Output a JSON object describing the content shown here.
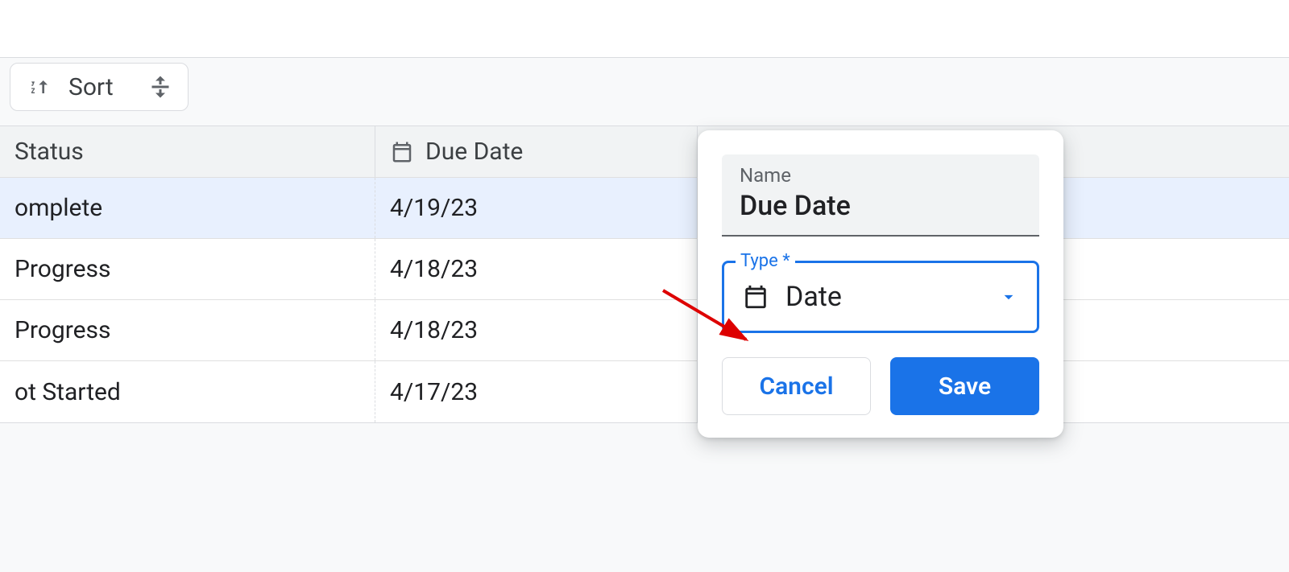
{
  "toolbar": {
    "sort_label": "Sort"
  },
  "table": {
    "columns": {
      "status": "Status",
      "due": "Due Date"
    },
    "rows": {
      "0": {
        "status": "omplete",
        "due": "4/19/23"
      },
      "1": {
        "status": "Progress",
        "due": "4/18/23"
      },
      "2": {
        "status": "Progress",
        "due": "4/18/23"
      },
      "3": {
        "status": "ot Started",
        "due": "4/17/23"
      }
    }
  },
  "popover": {
    "name_label": "Name",
    "name_value": "Due Date",
    "type_label": "Type *",
    "type_value": "Date",
    "cancel_label": "Cancel",
    "save_label": "Save"
  }
}
